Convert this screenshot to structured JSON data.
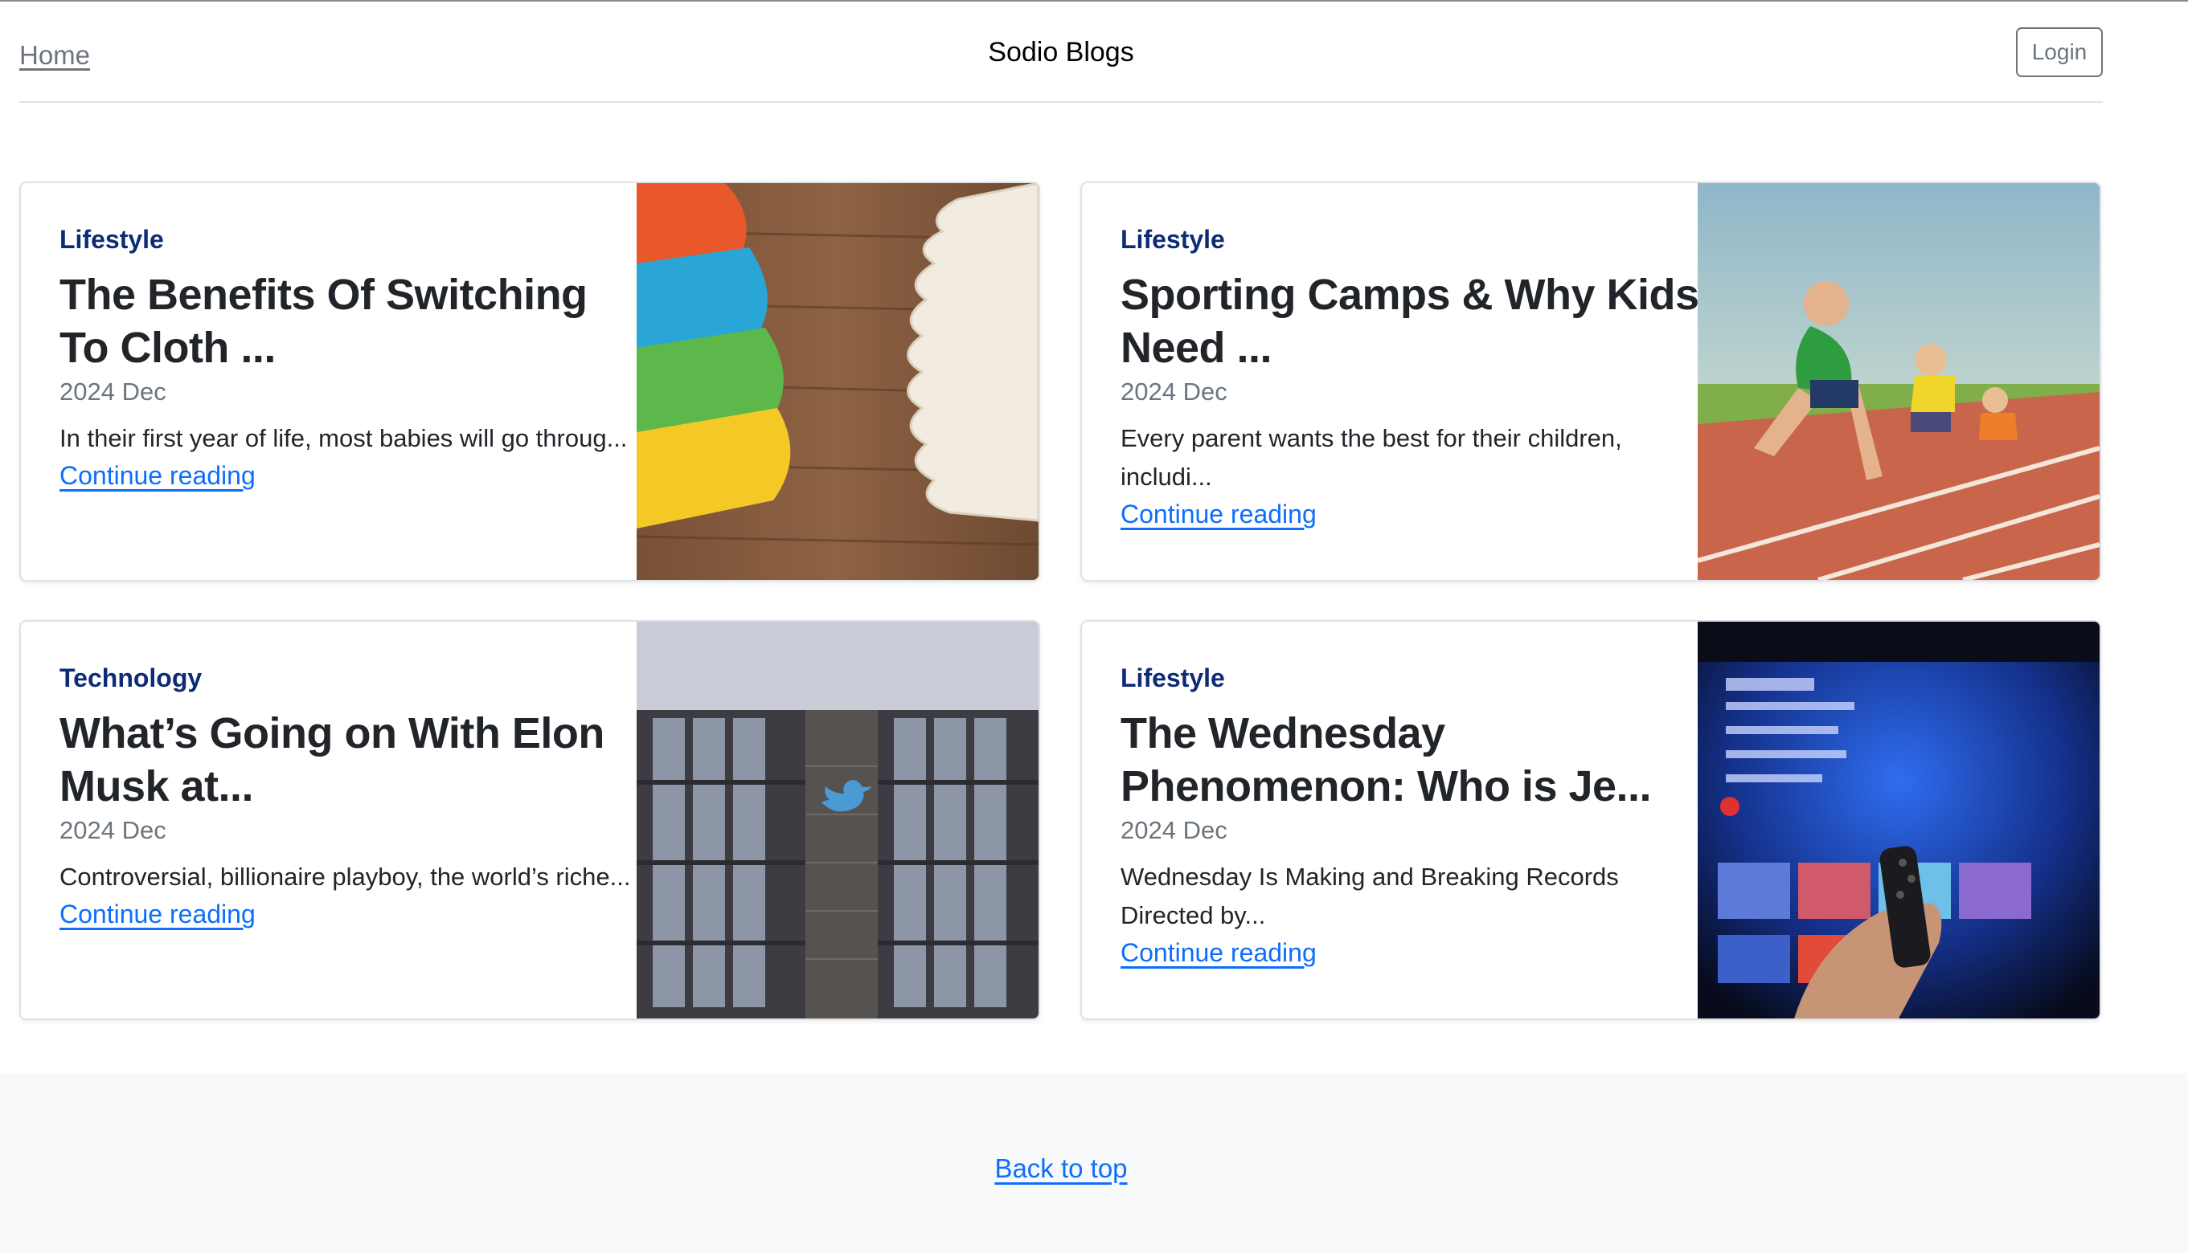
{
  "header": {
    "home_label": "Home",
    "brand": "Sodio Blogs",
    "login_label": "Login"
  },
  "posts": [
    {
      "category": "Lifestyle",
      "title": "The Benefits Of Switching To Cloth ...",
      "date": "2024 Dec",
      "excerpt": "In their first year of life, most babies will go throug...",
      "link_label": "Continue reading",
      "image": "cloth-diapers-photo"
    },
    {
      "category": "Lifestyle",
      "title": "Sporting Camps & Why Kids Need ...",
      "date": "2024 Dec",
      "excerpt": "Every parent wants the best for their children, includi...",
      "link_label": "Continue reading",
      "image": "kids-race-photo"
    },
    {
      "category": "Technology",
      "title": "What’s Going on With Elon Musk at...",
      "date": "2024 Dec",
      "excerpt": "Controversial, billionaire playboy, the world’s riche...",
      "link_label": "Continue reading",
      "image": "twitter-building-photo"
    },
    {
      "category": "Lifestyle",
      "title": "The Wednesday Phenomenon: Who is Je...",
      "date": "2024 Dec",
      "excerpt": "Wednesday Is Making and Breaking Records Directed by...",
      "link_label": "Continue reading",
      "image": "tv-remote-photo"
    }
  ],
  "footer": {
    "back_to_top": "Back to top"
  },
  "colors": {
    "category": "#0d2c74",
    "link": "#0d6efd",
    "muted": "#6c757d",
    "footer_bg": "#f8f9fa"
  }
}
